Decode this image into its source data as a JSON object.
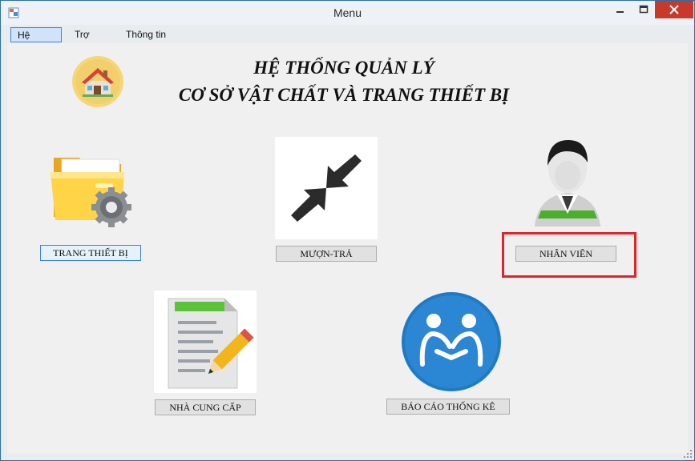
{
  "window": {
    "title": "Menu"
  },
  "menu": {
    "items": [
      "Hệ thống",
      "Trợ giúp",
      "Thông tin"
    ]
  },
  "header": {
    "line1": "HỆ THỐNG QUẢN LÝ",
    "line2": "CƠ SỞ VẬT CHẤT VÀ TRANG THIẾT BỊ"
  },
  "buttons": {
    "equipment": "TRANG THIẾT BỊ",
    "borrow_return": "MƯỢN-TRẢ",
    "staff": "NHÂN VIÊN",
    "supplier": "NHÀ CUNG CẤP",
    "report": "BÁO CÁO THỐNG KÊ"
  },
  "colors": {
    "highlight": "#e0242b",
    "close": "#c7392b",
    "accent": "#3c84d6"
  }
}
